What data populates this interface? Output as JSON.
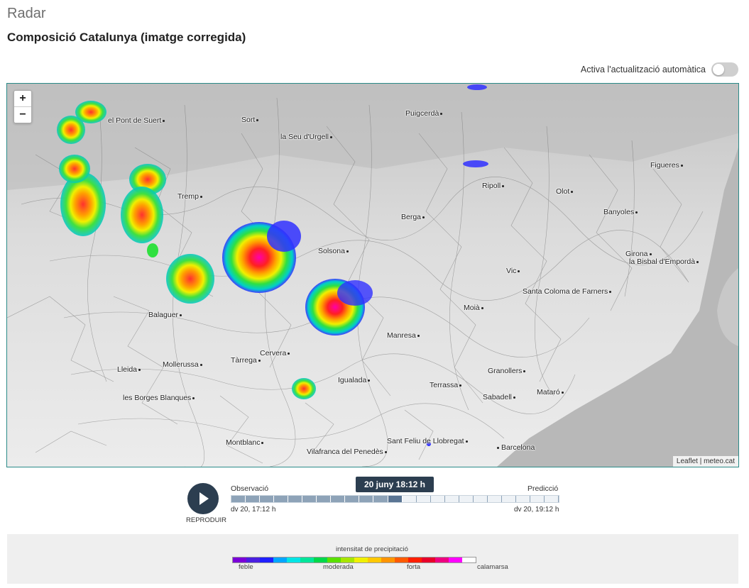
{
  "header": {
    "section": "Radar",
    "title": "Composició Catalunya (imatge corregida)"
  },
  "auto_update": {
    "label": "Activa l'actualització automàtica",
    "enabled": false
  },
  "map": {
    "zoom_in": "+",
    "zoom_out": "−",
    "attribution": "Leaflet | meteo.cat",
    "places": [
      "el Pont de Suert",
      "Sort",
      "la Seu d'Urgell",
      "Puigcerdà",
      "Figueres",
      "Ripoll",
      "Olot",
      "Banyoles",
      "Tremp",
      "Berga",
      "Solsona",
      "Girona",
      "la Bisbal d'Empordà",
      "Vic",
      "Santa Coloma de Farners",
      "Balaguer",
      "Moià",
      "Manresa",
      "Lleida",
      "Mollerussa",
      "Cervera",
      "Tàrrega",
      "Igualada",
      "Granollers",
      "Terrassa",
      "Sabadell",
      "Mataró",
      "les Borges Blanques",
      "Montblanc",
      "Sant Feliu de Llobregat",
      "Vilafranca del Penedès",
      "Barcelona"
    ]
  },
  "player": {
    "play_label": "REPRODUIR",
    "observation_label": "Observació",
    "prediction_label": "Predicció",
    "current_time": "20 juny 18:12 h",
    "start_time": "dv 20, 17:12 h",
    "end_time": "dv 20, 19:12 h",
    "past_steps": 11,
    "current_step": 1,
    "future_steps": 11
  },
  "legend": {
    "title": "intensitat de precipitació",
    "labels": [
      "feble",
      "moderada",
      "forta",
      "calamarsa"
    ],
    "colors": [
      "#7a00d8",
      "#4a1ee0",
      "#1f1fff",
      "#00a6ff",
      "#00e5e5",
      "#00e59a",
      "#00d84a",
      "#5ae000",
      "#a8e600",
      "#f0f000",
      "#ffc800",
      "#ff9400",
      "#ff5a00",
      "#ff1e00",
      "#e8002a",
      "#ee0080",
      "#ff00ff",
      "#ffffff"
    ]
  }
}
